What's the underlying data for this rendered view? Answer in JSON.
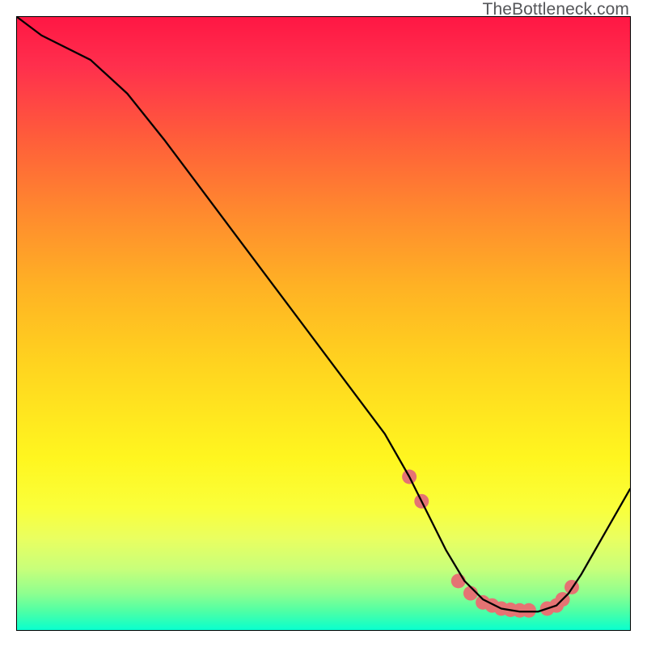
{
  "watermark": "TheBottleneck.com",
  "chart_data": {
    "type": "line",
    "title": "",
    "xlabel": "",
    "ylabel": "",
    "xlim": [
      0,
      100
    ],
    "ylim": [
      0,
      100
    ],
    "series": [
      {
        "name": "curve",
        "x": [
          0,
          4,
          12,
          18,
          24,
          30,
          36,
          42,
          48,
          54,
          60,
          64,
          67,
          70,
          73,
          76,
          79,
          82,
          85,
          88,
          90,
          92,
          94,
          96,
          98,
          100
        ],
        "y": [
          100,
          97,
          93,
          87.5,
          80,
          72,
          64,
          56,
          48,
          40,
          32,
          25,
          19,
          13,
          8,
          5,
          3.5,
          3,
          3,
          4,
          6,
          9,
          12.5,
          16,
          19.5,
          23
        ]
      }
    ],
    "markers": {
      "name": "dots",
      "x": [
        64,
        66,
        72,
        74,
        76,
        77.5,
        79,
        80.5,
        82,
        83.5,
        86.5,
        88,
        89,
        90.5
      ],
      "y": [
        25,
        21,
        8,
        6,
        4.5,
        4,
        3.5,
        3.3,
        3.2,
        3.2,
        3.5,
        4,
        5,
        7
      ],
      "color": "#e57373",
      "radius": 9
    },
    "background": {
      "type": "vertical-gradient",
      "stops": [
        {
          "pos": 0,
          "color": "#ff1744"
        },
        {
          "pos": 8,
          "color": "#ff2f4d"
        },
        {
          "pos": 20,
          "color": "#ff5e3a"
        },
        {
          "pos": 32,
          "color": "#ff8a2e"
        },
        {
          "pos": 44,
          "color": "#ffb224"
        },
        {
          "pos": 56,
          "color": "#ffd21f"
        },
        {
          "pos": 66,
          "color": "#ffe91f"
        },
        {
          "pos": 72,
          "color": "#fff61f"
        },
        {
          "pos": 80,
          "color": "#faff3a"
        },
        {
          "pos": 85,
          "color": "#eaff60"
        },
        {
          "pos": 90,
          "color": "#c8ff7a"
        },
        {
          "pos": 94,
          "color": "#8fff8f"
        },
        {
          "pos": 97,
          "color": "#4dffa6"
        },
        {
          "pos": 99,
          "color": "#1fffc0"
        },
        {
          "pos": 100,
          "color": "#0affd0"
        }
      ]
    }
  }
}
